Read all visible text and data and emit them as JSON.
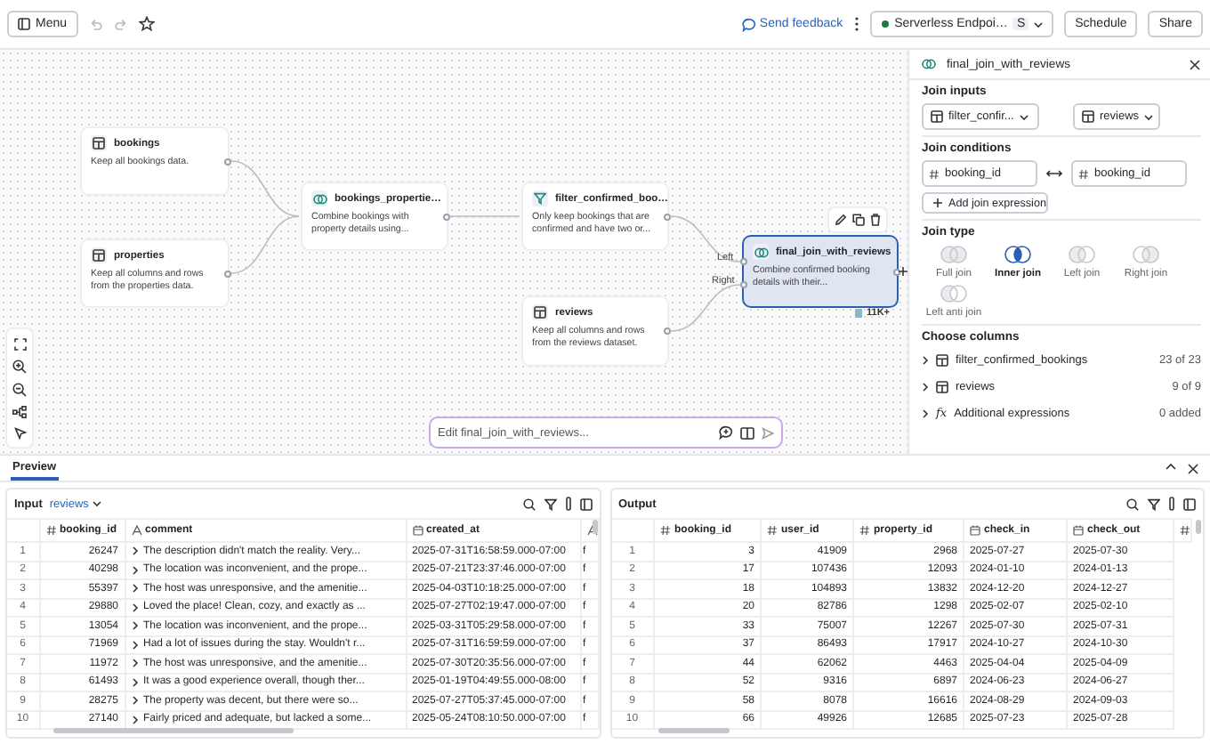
{
  "top_bar": {
    "menu_button": "Menu",
    "feedback_link": "Send feedback",
    "compute": {
      "label": "Serverless Endpoi…",
      "badge": "S"
    },
    "buttons": [
      "Schedule",
      "Share"
    ]
  },
  "canvas": {
    "nodes": [
      {
        "kind": "table",
        "title": "bookings",
        "description": "Keep all bookings data.",
        "selected": false
      },
      {
        "kind": "table",
        "title": "properties",
        "description": "Keep all columns and rows from the properties data.",
        "selected": false
      },
      {
        "kind": "join",
        "title": "bookings_propertie…",
        "description": "Combine bookings with property details using...",
        "selected": false
      },
      {
        "kind": "filter",
        "title": "filter_confirmed_boo…",
        "description": "Only keep bookings that are confirmed and have two or...",
        "selected": false
      },
      {
        "kind": "table",
        "title": "reviews",
        "description": "Keep all columns and rows from the reviews dataset.",
        "selected": false
      },
      {
        "kind": "join",
        "title": "final_join_with_reviews",
        "description": "Combine confirmed booking details with their...",
        "selected": true
      }
    ],
    "port_labels": [
      "Left",
      "Right"
    ],
    "row_count": "11K+",
    "prompt": {
      "placeholder": "Edit final_join_with_reviews..."
    }
  },
  "details": {
    "title": "final_join_with_reviews",
    "join_inputs": {
      "label": "Join inputs",
      "inputs": [
        "filter_confir...",
        "reviews"
      ]
    },
    "join_conditions": {
      "label": "Join conditions",
      "left": "booking_id",
      "right": "booking_id",
      "add_button": "Add join expression"
    },
    "join_type": {
      "label": "Join type",
      "options": [
        {
          "kind": "full",
          "label": "Full join",
          "selected": false
        },
        {
          "kind": "inner",
          "label": "Inner join",
          "selected": true
        },
        {
          "kind": "left",
          "label": "Left join",
          "selected": false
        },
        {
          "kind": "right",
          "label": "Right join",
          "selected": false
        },
        {
          "kind": "left_anti",
          "label": "Left anti join",
          "selected": false
        }
      ]
    },
    "choose_columns": {
      "label": "Choose columns",
      "groups": [
        {
          "kind": "table",
          "name": "filter_confirmed_bookings",
          "count": "23 of 23"
        },
        {
          "kind": "table",
          "name": "reviews",
          "count": "9 of 9"
        },
        {
          "kind": "expression",
          "symbol": "fx",
          "name": "Additional expressions",
          "count": "0 added"
        }
      ]
    }
  },
  "preview": {
    "tabs": [
      {
        "label": "Preview",
        "selected": true
      }
    ],
    "input": {
      "label": "Input",
      "source": "reviews",
      "columns": [
        {
          "kind": "index"
        },
        {
          "kind": "number",
          "name": "booking_id"
        },
        {
          "kind": "text",
          "name": "comment"
        },
        {
          "kind": "date",
          "name": "created_at"
        },
        {
          "kind": "text"
        }
      ],
      "rows": [
        [
          "1",
          "26247",
          "The description didn't match the reality. Very...",
          "2025-07-31T16:58:59.000-07:00",
          "f"
        ],
        [
          "2",
          "40298",
          "The location was inconvenient, and the prope...",
          "2025-07-21T23:37:46.000-07:00",
          "f"
        ],
        [
          "3",
          "55397",
          "The host was unresponsive, and the amenitie...",
          "2025-04-03T10:18:25.000-07:00",
          "f"
        ],
        [
          "4",
          "29880",
          "Loved the place! Clean, cozy, and exactly as ...",
          "2025-07-27T02:19:47.000-07:00",
          "f"
        ],
        [
          "5",
          "13054",
          "The location was inconvenient, and the prope...",
          "2025-03-31T05:29:58.000-07:00",
          "f"
        ],
        [
          "6",
          "71969",
          "Had a lot of issues during the stay. Wouldn't r...",
          "2025-07-31T16:59:59.000-07:00",
          "f"
        ],
        [
          "7",
          "11972",
          "The host was unresponsive, and the amenitie...",
          "2025-07-30T20:35:56.000-07:00",
          "f"
        ],
        [
          "8",
          "61493",
          "It was a good experience overall, though ther...",
          "2025-01-19T04:49:55.000-08:00",
          "f"
        ],
        [
          "9",
          "28275",
          "The property was decent, but there were so...",
          "2025-07-27T05:37:45.000-07:00",
          "f"
        ],
        [
          "10",
          "27140",
          "Fairly priced and adequate, but lacked a some...",
          "2025-05-24T08:10:50.000-07:00",
          "f"
        ]
      ]
    },
    "output": {
      "label": "Output",
      "columns": [
        {
          "kind": "index"
        },
        {
          "kind": "number",
          "name": "booking_id"
        },
        {
          "kind": "number",
          "name": "user_id"
        },
        {
          "kind": "number",
          "name": "property_id"
        },
        {
          "kind": "date",
          "name": "check_in"
        },
        {
          "kind": "date",
          "name": "check_out"
        },
        {
          "kind": "number"
        }
      ],
      "rows": [
        [
          "1",
          "3",
          "41909",
          "2968",
          "2025-07-27",
          "2025-07-30"
        ],
        [
          "2",
          "17",
          "107436",
          "12093",
          "2024-01-10",
          "2024-01-13"
        ],
        [
          "3",
          "18",
          "104893",
          "13832",
          "2024-12-20",
          "2024-12-27"
        ],
        [
          "4",
          "20",
          "82786",
          "1298",
          "2025-02-07",
          "2025-02-10"
        ],
        [
          "5",
          "33",
          "75007",
          "12267",
          "2025-07-30",
          "2025-07-31"
        ],
        [
          "6",
          "37",
          "86493",
          "17917",
          "2024-10-27",
          "2024-10-30"
        ],
        [
          "7",
          "44",
          "62062",
          "4463",
          "2025-04-04",
          "2025-04-09"
        ],
        [
          "8",
          "52",
          "9316",
          "6897",
          "2024-06-23",
          "2024-06-27"
        ],
        [
          "9",
          "58",
          "8078",
          "16616",
          "2024-08-29",
          "2024-09-03"
        ],
        [
          "10",
          "66",
          "49926",
          "12685",
          "2025-07-23",
          "2025-07-28"
        ]
      ]
    }
  }
}
